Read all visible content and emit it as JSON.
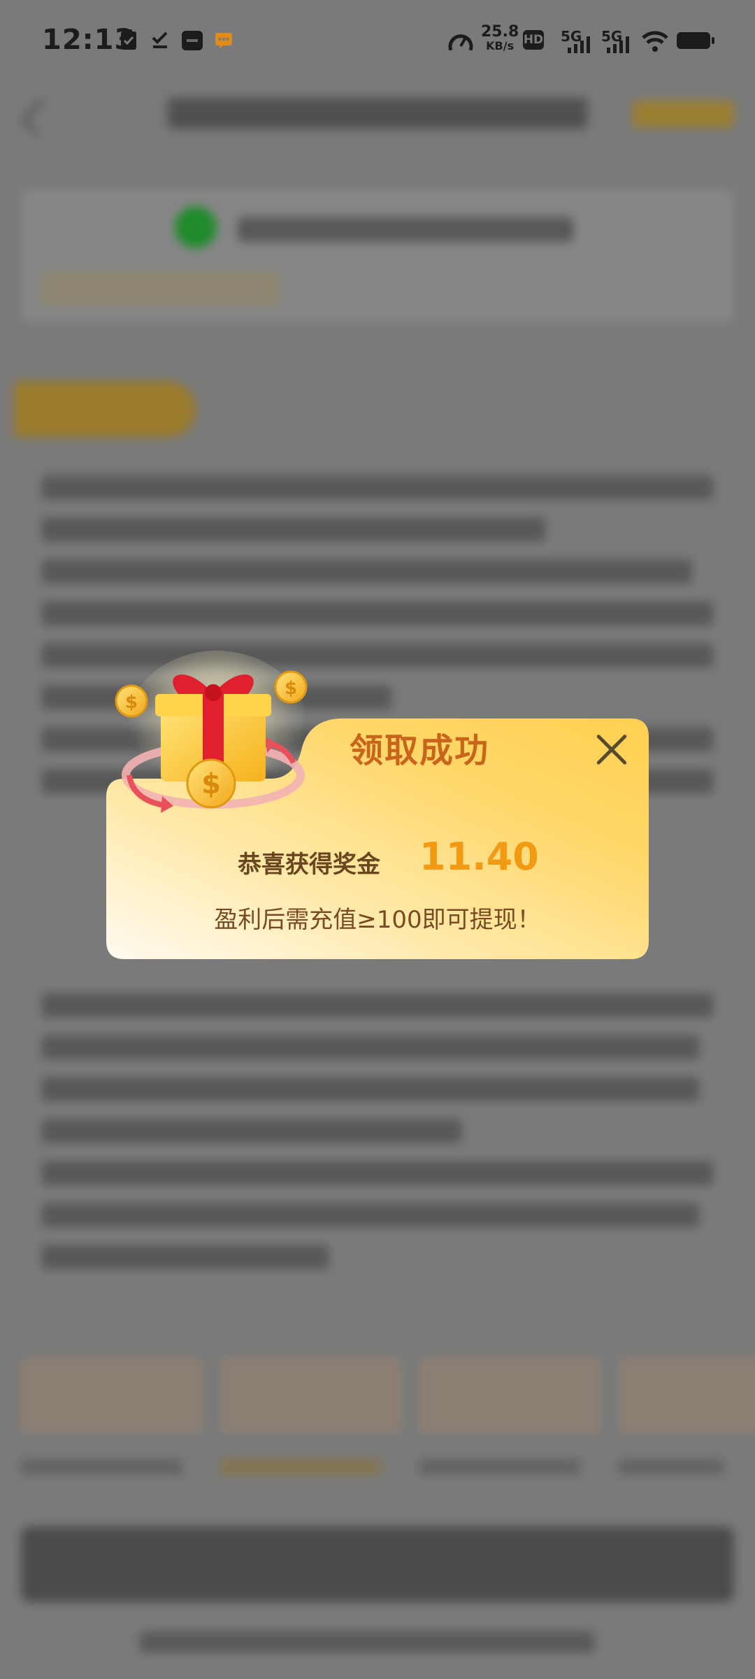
{
  "status_bar": {
    "time": "12:13",
    "net_speed_value": "25.8",
    "net_speed_unit": "KB/s",
    "hd_label": "HD",
    "sim1_label": "5G",
    "sim2_label": "5G"
  },
  "dialog": {
    "title": "领取成功",
    "reward_label": "恭喜获得奖金",
    "reward_amount": "11.40",
    "hint": "盈利后需充值≥100即可提现！"
  },
  "colors": {
    "accent_orange": "#f29a14",
    "title_orange": "#c8651a",
    "dialog_top": "#ffd25a",
    "dialog_bottom": "#fffaf0"
  }
}
